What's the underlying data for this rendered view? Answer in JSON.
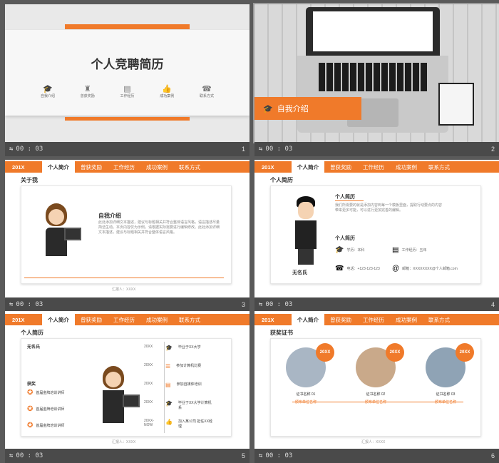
{
  "slides": [
    {
      "number": "1",
      "time": "00 : 03",
      "title": "个人竞聘简历",
      "icons": [
        {
          "label": "自我介绍",
          "icon": "graduation-cap-icon"
        },
        {
          "label": "曾获奖励",
          "icon": "trophy-icon"
        },
        {
          "label": "工作经历",
          "icon": "document-icon"
        },
        {
          "label": "成功案例",
          "icon": "thumbs-up-icon"
        },
        {
          "label": "联系方式",
          "icon": "phone-icon"
        }
      ]
    },
    {
      "number": "2",
      "time": "00 : 03",
      "banner": "自我介绍"
    },
    {
      "number": "3",
      "time": "00 : 03",
      "section": "关于我",
      "heading": "自我介绍",
      "body": "此处添加详细文本描述，建议与标题相关并符合整体语言风格，语言描述尽量简洁生动。本页内容仅为示例，请根据实际需要进行编辑修改。此处添加详细文本描述，建议与标题相关并符合整体语言风格。"
    },
    {
      "number": "4",
      "time": "00 : 03",
      "section": "个人简历",
      "name": "无名氏",
      "heading": "个人简历",
      "heading2": "个人简历",
      "body": "我们所需要的就是添加内容到每一个模板里面，提取行动要点的内容带来更多可能，可以进行更加完善的编辑。",
      "info": [
        {
          "icon": "graduation-cap-icon",
          "text": "学历：本科"
        },
        {
          "icon": "document-icon",
          "text": "工作经历：五年"
        },
        {
          "icon": "phone-icon",
          "text": "电话：+123-123-123"
        },
        {
          "icon": "email-icon",
          "text": "邮箱：XXXXXXXX@个人邮箱.com"
        }
      ]
    },
    {
      "number": "5",
      "time": "00 : 03",
      "section": "个人简历",
      "profile_name": "无名氏",
      "awards_title": "获奖",
      "awards": [
        "首届金牌培训讲师",
        "首届金牌培训讲师",
        "首届金牌培训讲师"
      ],
      "timeline": [
        {
          "year": "20XX",
          "text": "毕业于XX大学"
        },
        {
          "year": "20XX",
          "text": "参加计算机比赛"
        },
        {
          "year": "20XX",
          "text": "参加自媒体培训"
        },
        {
          "year": "20XX",
          "text": "毕业于XX大学计算机系"
        },
        {
          "year": "20XX-NOW",
          "text": "加入某公司 担任XX经理"
        }
      ]
    },
    {
      "number": "6",
      "time": "00 : 03",
      "section": "获奖证书",
      "certs": [
        {
          "badge": "20XX",
          "name": "证书名称 01",
          "org": "颁布单位名称"
        },
        {
          "badge": "20XX",
          "name": "证书名称 02",
          "org": "颁布单位名称"
        },
        {
          "badge": "20XX",
          "name": "证书名称 03",
          "org": "颁布单位名称"
        }
      ]
    }
  ],
  "header": {
    "year": "201X",
    "tabs": [
      "个人简介",
      "曾获奖励",
      "工作经历",
      "成功案例",
      "联系方式"
    ]
  },
  "footer_sig": "汇报人：XXXX",
  "colors": {
    "accent": "#f07a2a",
    "bar": "#4a4a4a",
    "bg": "#5a5a5a"
  }
}
